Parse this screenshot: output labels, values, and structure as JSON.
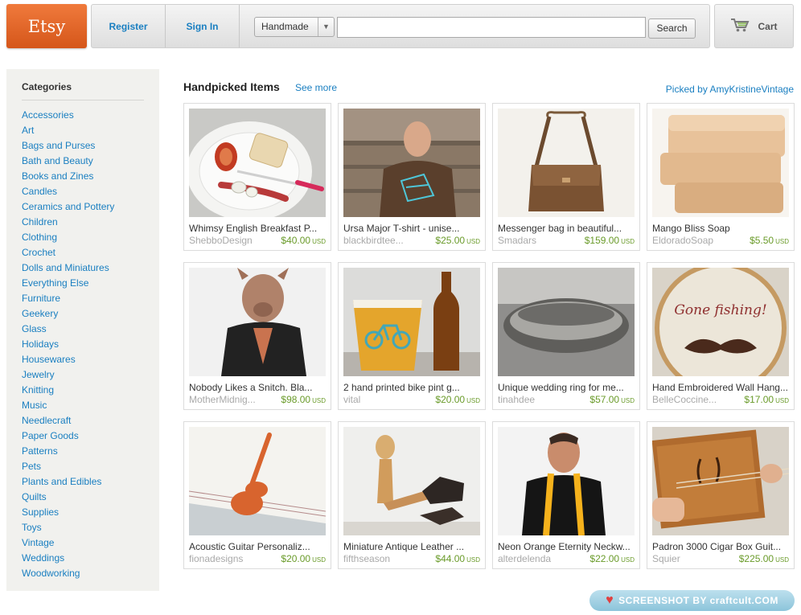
{
  "header": {
    "logo_text": "Etsy",
    "register_label": "Register",
    "signin_label": "Sign In",
    "search": {
      "category": "Handmade",
      "value": "",
      "placeholder": "",
      "button_label": "Search"
    },
    "cart_label": "Cart"
  },
  "sidebar": {
    "title": "Categories",
    "items": [
      "Accessories",
      "Art",
      "Bags and Purses",
      "Bath and Beauty",
      "Books and Zines",
      "Candles",
      "Ceramics and Pottery",
      "Children",
      "Clothing",
      "Crochet",
      "Dolls and Miniatures",
      "Everything Else",
      "Furniture",
      "Geekery",
      "Glass",
      "Holidays",
      "Housewares",
      "Jewelry",
      "Knitting",
      "Music",
      "Needlecraft",
      "Paper Goods",
      "Patterns",
      "Pets",
      "Plants and Edibles",
      "Quilts",
      "Supplies",
      "Toys",
      "Vintage",
      "Weddings",
      "Woodworking"
    ]
  },
  "main": {
    "title": "Handpicked Items",
    "see_more": "See more",
    "picked_by": "Picked by AmyKristineVintage",
    "currency": "USD",
    "items": [
      {
        "title": "Whimsy English Breakfast P...",
        "shop": "ShebboDesign",
        "price": "$40.00",
        "image_icon": "breakfast-plate"
      },
      {
        "title": "Ursa Major T-shirt - unise...",
        "shop": "blackbirdtee...",
        "price": "$25.00",
        "image_icon": "tshirt-man"
      },
      {
        "title": "Messenger bag in beautiful...",
        "shop": "Smadars",
        "price": "$159.00",
        "image_icon": "leather-bag"
      },
      {
        "title": "Mango Bliss Soap",
        "shop": "EldoradoSoap",
        "price": "$5.50",
        "image_icon": "soap-bars"
      },
      {
        "title": "Nobody Likes a Snitch. Bla...",
        "shop": "MotherMidnig...",
        "price": "$98.00",
        "image_icon": "pig-mask"
      },
      {
        "title": "2 hand printed bike pint g...",
        "shop": "vital",
        "price": "$20.00",
        "image_icon": "beer-glass"
      },
      {
        "title": "Unique wedding ring for me...",
        "shop": "tinahdee",
        "price": "$57.00",
        "image_icon": "silver-ring"
      },
      {
        "title": "Hand Embroidered Wall Hang...",
        "shop": "BelleCoccine...",
        "price": "$17.00",
        "image_icon": "embroidery-hoop",
        "image_text": "Gone fishing!"
      },
      {
        "title": "Acoustic Guitar Personaliz...",
        "shop": "fionadesigns",
        "price": "$20.00",
        "image_icon": "guitar-card"
      },
      {
        "title": "Miniature Antique Leather ...",
        "shop": "fifthseason",
        "price": "$44.00",
        "image_icon": "wooden-mannequin"
      },
      {
        "title": "Neon Orange Eternity Neckw...",
        "shop": "alterdelenda",
        "price": "$22.00",
        "image_icon": "orange-scarf-man"
      },
      {
        "title": "Padron 3000 Cigar Box Guit...",
        "shop": "Squier",
        "price": "$225.00",
        "image_icon": "cigar-box-guitar"
      }
    ]
  },
  "footer": {
    "badge_text": "SCREENSHOT BY craftcult.COM"
  },
  "colors": {
    "link": "#1a7fc1",
    "price": "#6a9b2a",
    "logo": "#e8692c",
    "shop": "#a9a9a9"
  }
}
